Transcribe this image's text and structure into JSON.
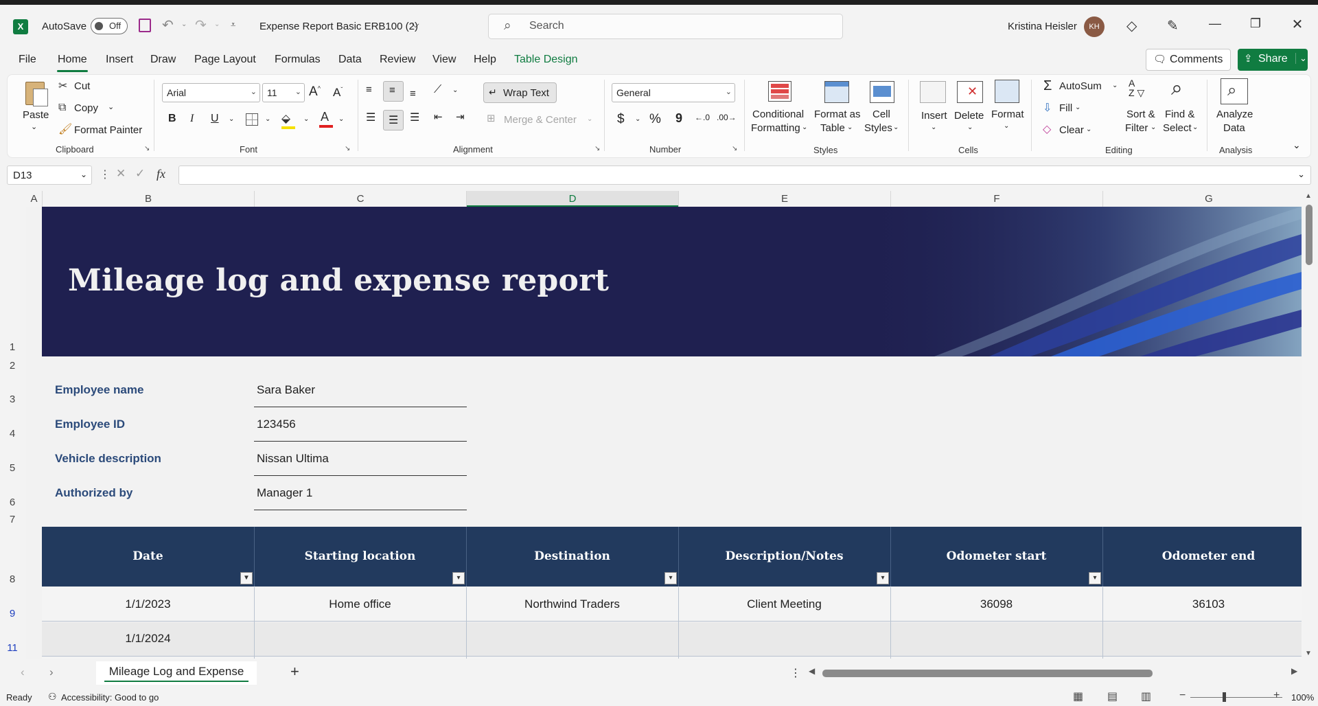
{
  "titlebar": {
    "autosave_label": "AutoSave",
    "autosave_state": "Off",
    "doc_title": "Expense Report Basic ERB100 (2)",
    "search_placeholder": "Search",
    "user_name": "Kristina Heisler",
    "user_initials": "KH"
  },
  "menu": {
    "tabs": [
      "File",
      "Home",
      "Insert",
      "Draw",
      "Page Layout",
      "Formulas",
      "Data",
      "Review",
      "View",
      "Help",
      "Table Design"
    ],
    "active": "Home",
    "comments_label": "Comments",
    "share_label": "Share"
  },
  "ribbon": {
    "clipboard": {
      "paste": "Paste",
      "cut": "Cut",
      "copy": "Copy",
      "format_painter": "Format Painter",
      "group": "Clipboard"
    },
    "font": {
      "name": "Arial",
      "size": "11",
      "group": "Font"
    },
    "alignment": {
      "wrap_text": "Wrap Text",
      "merge_center": "Merge & Center",
      "group": "Alignment"
    },
    "number": {
      "format": "General",
      "group": "Number"
    },
    "styles": {
      "conditional_1": "Conditional",
      "conditional_2": "Formatting",
      "format_table_1": "Format as",
      "format_table_2": "Table",
      "cell_styles_1": "Cell",
      "cell_styles_2": "Styles",
      "group": "Styles"
    },
    "cells": {
      "insert": "Insert",
      "delete": "Delete",
      "format": "Format",
      "group": "Cells"
    },
    "editing": {
      "autosum": "AutoSum",
      "fill": "Fill",
      "clear": "Clear",
      "sort_1": "Sort &",
      "sort_2": "Filter",
      "find_1": "Find &",
      "find_2": "Select",
      "group": "Editing"
    },
    "analysis": {
      "analyze_1": "Analyze",
      "analyze_2": "Data",
      "group": "Analysis"
    }
  },
  "formula_bar": {
    "cell_ref": "D13",
    "fx": "fx",
    "content": ""
  },
  "grid": {
    "columns": [
      "A",
      "B",
      "C",
      "D",
      "E",
      "F",
      "G"
    ],
    "selected_column": "D",
    "rows": [
      "1",
      "2",
      "3",
      "4",
      "5",
      "6",
      "7",
      "8",
      "9",
      "11"
    ]
  },
  "report": {
    "title": "Mileage log and expense report",
    "info": [
      {
        "label": "Employee name",
        "value": "Sara Baker"
      },
      {
        "label": "Employee ID",
        "value": "123456"
      },
      {
        "label": "Vehicle description",
        "value": "Nissan Ultima"
      },
      {
        "label": "Authorized by",
        "value": "Manager 1"
      }
    ],
    "table_headers": [
      "Date",
      "Starting location",
      "Destination",
      "Description/Notes",
      "Odometer start",
      "Odometer end"
    ],
    "table_rows": [
      [
        "1/1/2023",
        "Home office",
        "Northwind Traders",
        "Client Meeting",
        "36098",
        "36103"
      ],
      [
        "1/1/2024",
        "",
        "",
        "",
        "",
        ""
      ]
    ]
  },
  "sheet_tabs": {
    "active": "Mileage Log and Expense"
  },
  "status": {
    "ready": "Ready",
    "accessibility": "Accessibility: Good to go",
    "zoom": "100%"
  }
}
